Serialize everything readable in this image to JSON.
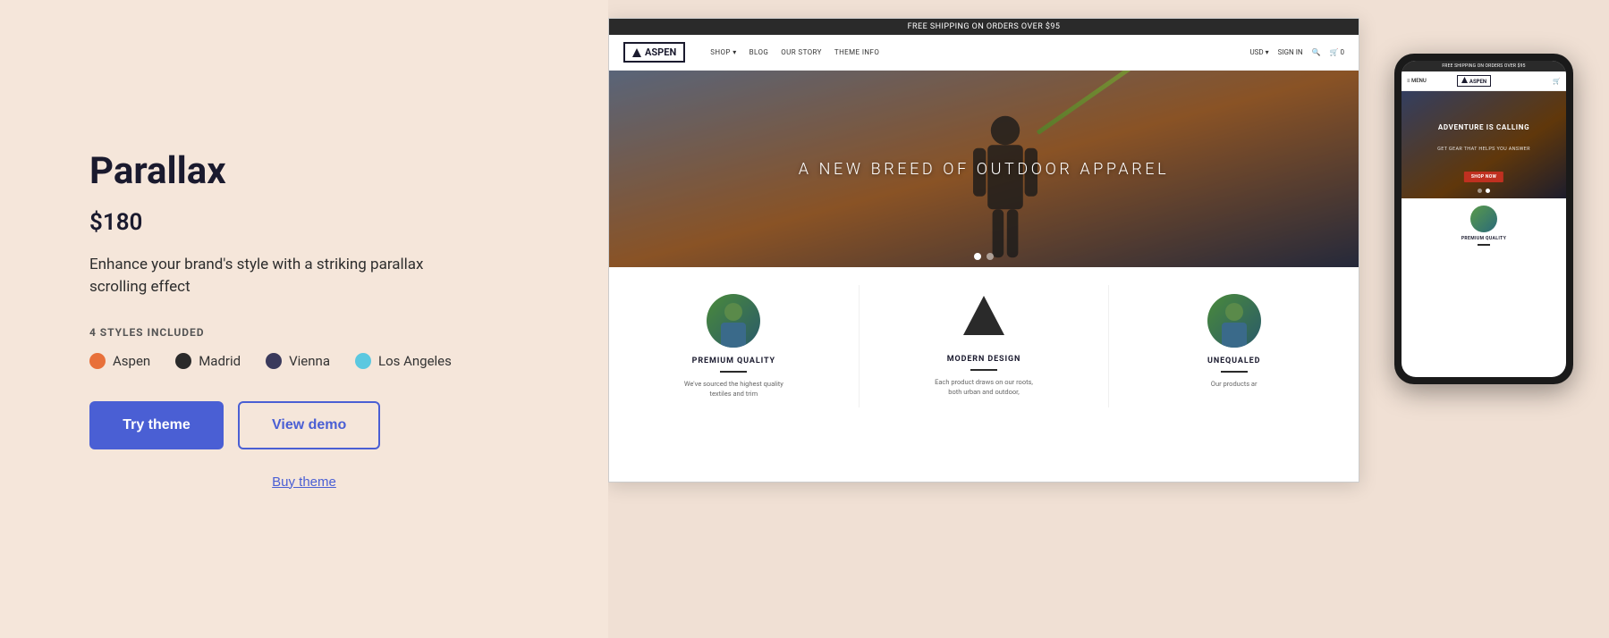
{
  "left": {
    "title": "Parallax",
    "price": "$180",
    "description": "Enhance your brand's style with a striking parallax scrolling effect",
    "styles_label": "4 STYLES INCLUDED",
    "style_options": [
      {
        "name": "Aspen",
        "color_class": "aspen"
      },
      {
        "name": "Madrid",
        "color_class": "madrid"
      },
      {
        "name": "Vienna",
        "color_class": "vienna"
      },
      {
        "name": "Los Angeles",
        "color_class": "los-angeles"
      }
    ],
    "try_theme_label": "Try theme",
    "view_demo_label": "View demo",
    "buy_theme_label": "Buy theme"
  },
  "store_preview": {
    "topbar_text": "FREE SHIPPING ON ORDERS OVER $95",
    "logo": "ASPEN",
    "nav_links": [
      "SHOP",
      "BLOG",
      "OUR STORY",
      "THEME INFO"
    ],
    "nav_right": [
      "USD",
      "SIGN IN"
    ],
    "hero_text": "A NEW BREED OF OUTDOOR APPAREL",
    "features": [
      {
        "name": "PREMIUM QUALITY",
        "text": "We've sourced the highest quality textiles and trim"
      },
      {
        "name": "MODERN DESIGN",
        "text": "Each product draws on our roots, both urban and outdoor,"
      },
      {
        "name": "UNEQUALED",
        "text": "Our products ar"
      }
    ]
  },
  "mobile_preview": {
    "topbar_text": "FREE SHIPPING ON ORDERS OVER $95",
    "logo": "ASPEN",
    "menu_label": "MENU",
    "hero_text": "ADVENTURE IS CALLING",
    "hero_sub": "GET GEAR THAT HELPS YOU ANSWER",
    "cta_label": "SHOP NOW",
    "feature_name": "PREMIUM QUALITY"
  }
}
